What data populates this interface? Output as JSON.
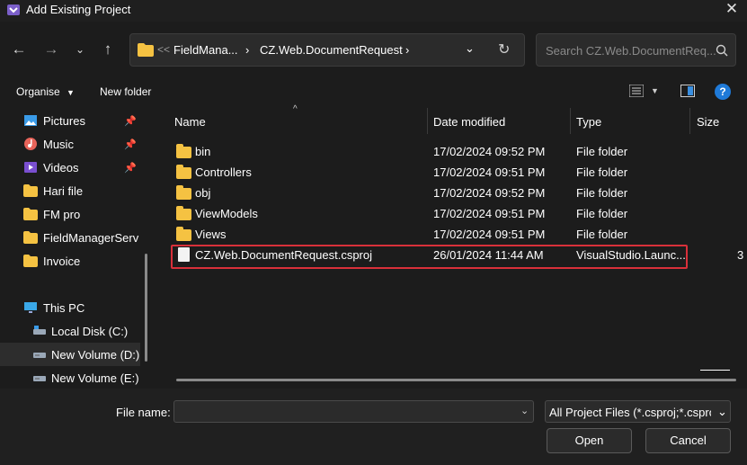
{
  "window": {
    "title": "Add Existing Project"
  },
  "navigation": {
    "breadcrumb": [
      "FieldMana...",
      "CZ.Web.DocumentRequest"
    ],
    "overflow": "<<"
  },
  "search": {
    "placeholder": "Search CZ.Web.DocumentReq..."
  },
  "toolbar": {
    "organise": "Organise",
    "new_folder": "New folder",
    "help": "?"
  },
  "sidebar": {
    "items": [
      {
        "label": "Pictures",
        "icon": "pictures-icon",
        "pinned": true
      },
      {
        "label": "Music",
        "icon": "music-icon",
        "pinned": true
      },
      {
        "label": "Videos",
        "icon": "videos-icon",
        "pinned": true
      },
      {
        "label": "Hari file",
        "icon": "folder-icon",
        "pinned": false
      },
      {
        "label": "FM pro",
        "icon": "folder-icon",
        "pinned": false
      },
      {
        "label": "FieldManagerServ",
        "icon": "folder-icon",
        "pinned": false
      },
      {
        "label": "Invoice",
        "icon": "folder-icon",
        "pinned": false
      },
      {
        "label": "This PC",
        "icon": "this-pc-icon",
        "pinned": false
      },
      {
        "label": "Local Disk (C:)",
        "icon": "drive-icon",
        "pinned": false
      },
      {
        "label": "New Volume (D:)",
        "icon": "drive-icon",
        "pinned": false,
        "selected": true
      },
      {
        "label": "New Volume (E:)",
        "icon": "drive-icon",
        "pinned": false
      }
    ]
  },
  "columns": [
    "Name",
    "Date modified",
    "Type",
    "Size"
  ],
  "files": [
    {
      "name": "bin",
      "date": "17/02/2024 09:52 PM",
      "type": "File folder",
      "size": "",
      "kind": "folder"
    },
    {
      "name": "Controllers",
      "date": "17/02/2024 09:51 PM",
      "type": "File folder",
      "size": "",
      "kind": "folder"
    },
    {
      "name": "obj",
      "date": "17/02/2024 09:52 PM",
      "type": "File folder",
      "size": "",
      "kind": "folder"
    },
    {
      "name": "ViewModels",
      "date": "17/02/2024 09:51 PM",
      "type": "File folder",
      "size": "",
      "kind": "folder"
    },
    {
      "name": "Views",
      "date": "17/02/2024 09:51 PM",
      "type": "File folder",
      "size": "",
      "kind": "folder"
    },
    {
      "name": "CZ.Web.DocumentRequest.csproj",
      "date": "26/01/2024 11:44 AM",
      "type": "VisualStudio.Launc...",
      "size": "3",
      "kind": "file",
      "highlighted": true
    }
  ],
  "bottom": {
    "file_name_label": "File name:",
    "file_name_value": "",
    "filter": "All Project Files (*.csproj;*.csproj",
    "open": "Open",
    "cancel": "Cancel"
  },
  "colors": {
    "highlight_border": "#d9303a",
    "folder": "#f5c242",
    "help_icon": "#1f7ad8"
  }
}
